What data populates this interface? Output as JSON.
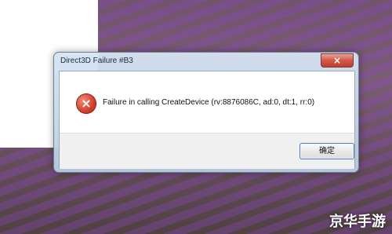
{
  "dialog": {
    "title": "Direct3D Failure #B3",
    "close_label": "×",
    "message": "Failure in calling CreateDevice (rv:8876086C, ad:0, dt:1, rr:0)",
    "ok_label": "确定",
    "icon": "error-icon"
  },
  "watermark": "京华手游",
  "colors": {
    "close_button": "#d3584a",
    "error_icon": "#d4412e",
    "dialog_frame": "#b7cde3"
  }
}
